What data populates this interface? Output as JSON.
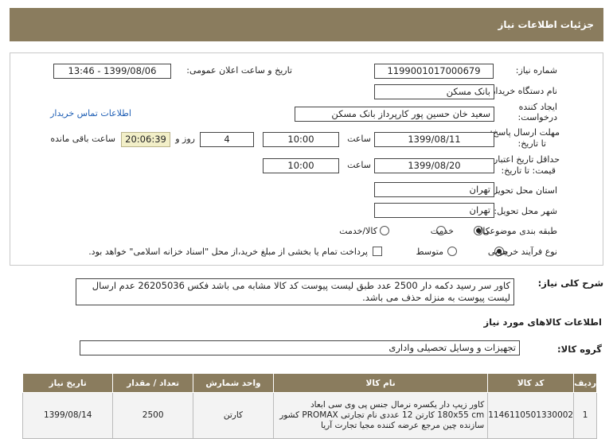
{
  "header": {
    "title": "جزئیات اطلاعات نیاز"
  },
  "form": {
    "need_number_label": "شماره نیاز:",
    "need_number": "1199001017000679",
    "announce_label": "تاریخ و ساعت اعلان عمومی:",
    "announce_value": "1399/08/06 - 13:46",
    "buyer_label": "نام دستگاه خریدار:",
    "buyer_value": "بانک مسکن",
    "creator_label_1": "ایجاد کننده",
    "creator_label_2": "درخواست:",
    "creator_value": "سعید  خان حسین پور کارپرداز بانک مسکن",
    "contact_link": "اطلاعات تماس خریدار",
    "reply_label_1": "مهلت ارسال پاسخ:",
    "reply_label_2": "تا تاریخ:",
    "reply_date": "1399/08/11",
    "time_label": "ساعت",
    "reply_time": "10:00",
    "days_value": "4",
    "days_label": "روز و",
    "remaining_value": "20:06:39",
    "remaining_label": "ساعت باقی مانده",
    "validity_label_1": "حداقل تاریخ اعتبار",
    "validity_label_2": "قیمت: تا تاریخ:",
    "validity_date": "1399/08/20",
    "validity_time": "10:00",
    "province_label": "استان محل تحویل:",
    "province_value": "تهران",
    "city_label": "شهر محل تحویل:",
    "city_value": "تهران",
    "category_label": "طبقه بندی موضوعی:",
    "category_options": [
      "کالا",
      "خدمت",
      "کالا/خدمت"
    ],
    "purchase_label": "نوع فرآیند خرید :",
    "purchase_options": [
      "جزیی",
      "متوسط"
    ],
    "payment_note": "پرداخت تمام یا بخشی از مبلغ خرید،از محل \"اسناد خزانه اسلامی\" خواهد بود."
  },
  "description": {
    "label": "شرح کلی نیاز:",
    "text": "کاور سر رسید دکمه دار 2500 عدد طبق لیست پیوست کد کالا مشابه می باشد فکس 26205036 عدم ارسال لیست پیوست به منزله حذف می باشد."
  },
  "goods": {
    "section_title": "اطلاعات کالاهای مورد نیاز",
    "group_label": "گروه کالا:",
    "group_value": "تجهیزات و وسایل تحصیلی واداری",
    "columns": [
      "ردیف",
      "کد کالا",
      "نام کالا",
      "واحد شمارش",
      "تعداد / مقدار",
      "تاریخ نیاز"
    ],
    "rows": [
      {
        "row": "1",
        "code": "1146110501330002",
        "name": "کاور زیپ دار یکسره نرمال جنس پی وی سی ابعاد 180x55 cm کارتن 12 عددی نام تجارتی PROMAX کشور سازنده چین مرجع عرضه کننده مجیا تجارت آریا",
        "unit": "کارتن",
        "qty": "2500",
        "date": "1399/08/14"
      }
    ]
  },
  "colors": {
    "header": "#8a7c5e",
    "timer_bg": "#f2efc8",
    "link": "#1f5fb5"
  }
}
